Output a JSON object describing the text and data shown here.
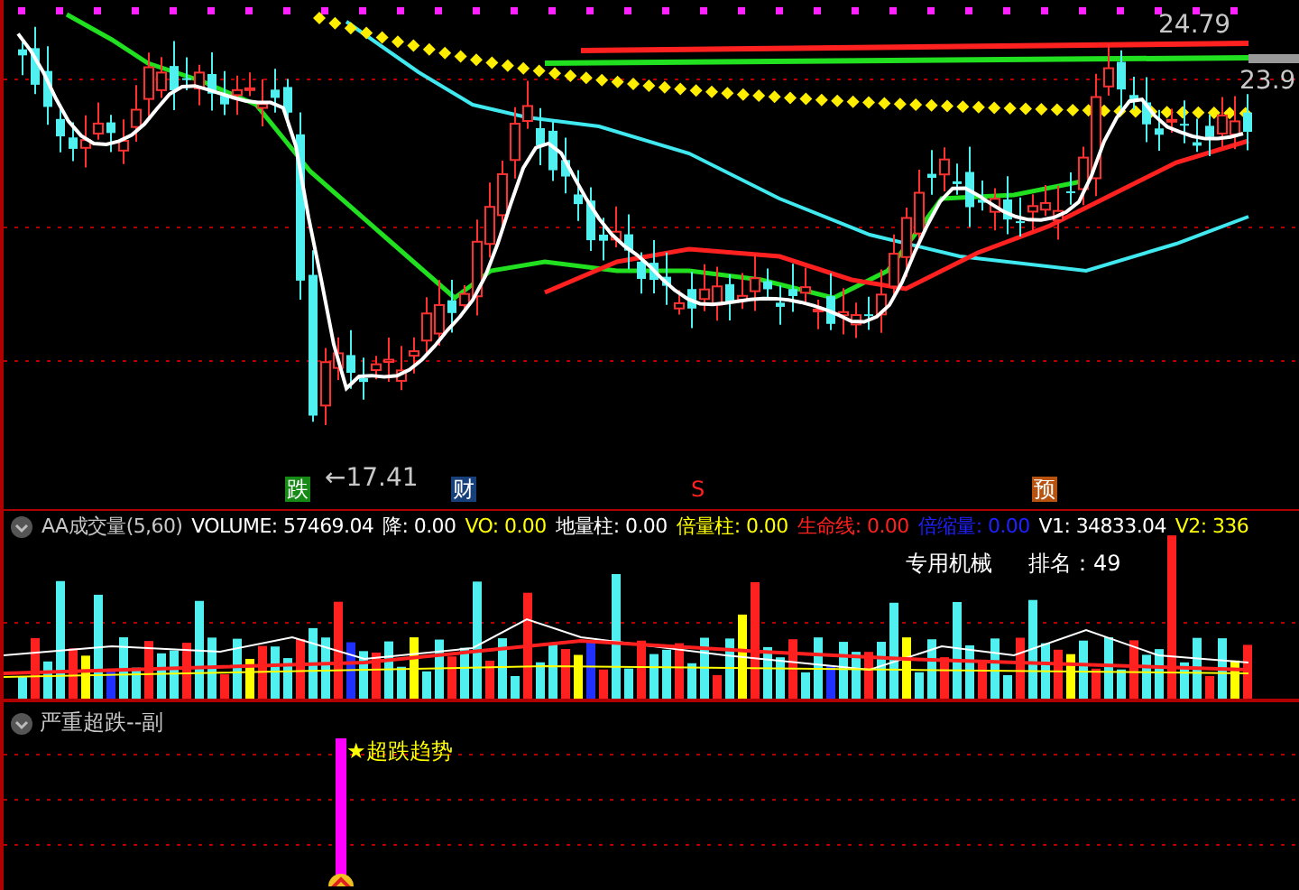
{
  "main_chart": {
    "price_labels": [
      {
        "text": "24.79"
      },
      {
        "text": "23.9"
      },
      {
        "text": "←17.41"
      }
    ],
    "signals": [
      {
        "text": "跌",
        "kind": "box",
        "color": "#158a15"
      },
      {
        "text": "财",
        "kind": "box",
        "color": "#173f7a"
      },
      {
        "text": "S",
        "kind": "plain",
        "color": "#ff2020"
      },
      {
        "text": "预",
        "kind": "box",
        "color": "#b8520f"
      }
    ]
  },
  "volume_panel": {
    "indicators": [
      {
        "text": "AA成交量(5,60)",
        "color": "#c8c8c8"
      },
      {
        "text": "VOLUME: 57469.04",
        "color": "#ffffff"
      },
      {
        "text": "降: 0.00",
        "color": "#ffffff"
      },
      {
        "text": "VO: 0.00",
        "color": "#ffff00"
      },
      {
        "text": "地量柱: 0.00",
        "color": "#ffffff"
      },
      {
        "text": "倍量柱: 0.00",
        "color": "#ffff00"
      },
      {
        "text": "生命线: 0.00",
        "color": "#ff2020"
      },
      {
        "text": "倍缩量: 0.00",
        "color": "#2020ff"
      },
      {
        "text": "V1: 34833.04",
        "color": "#ffffff"
      },
      {
        "text": "V2: 336",
        "color": "#ffff00"
      }
    ],
    "industry": "专用机械",
    "rank": "排名：49"
  },
  "sub_panel": {
    "title": "严重超跌--副",
    "signal_label": "★超跌趋势"
  }
}
